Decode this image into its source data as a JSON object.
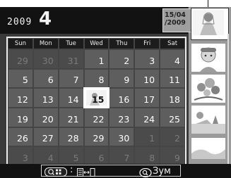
{
  "header": {
    "year": "2009",
    "month": "4"
  },
  "calendar": {
    "weekdays": [
      "Sun",
      "Mon",
      "Tue",
      "Wed",
      "Thu",
      "Fri",
      "Sat"
    ],
    "days": [
      {
        "d": "29",
        "cur": false
      },
      {
        "d": "30",
        "cur": false
      },
      {
        "d": "31",
        "cur": false
      },
      {
        "d": "1",
        "cur": true
      },
      {
        "d": "2",
        "cur": true
      },
      {
        "d": "3",
        "cur": true
      },
      {
        "d": "4",
        "cur": true
      },
      {
        "d": "5",
        "cur": true
      },
      {
        "d": "6",
        "cur": true
      },
      {
        "d": "7",
        "cur": true
      },
      {
        "d": "8",
        "cur": true
      },
      {
        "d": "9",
        "cur": true
      },
      {
        "d": "10",
        "cur": true
      },
      {
        "d": "11",
        "cur": true
      },
      {
        "d": "12",
        "cur": true
      },
      {
        "d": "13",
        "cur": true
      },
      {
        "d": "14",
        "cur": true
      },
      {
        "d": "15",
        "cur": true,
        "selected": true
      },
      {
        "d": "16",
        "cur": true
      },
      {
        "d": "17",
        "cur": true
      },
      {
        "d": "18",
        "cur": true
      },
      {
        "d": "19",
        "cur": true
      },
      {
        "d": "20",
        "cur": true
      },
      {
        "d": "21",
        "cur": true
      },
      {
        "d": "22",
        "cur": true
      },
      {
        "d": "23",
        "cur": true
      },
      {
        "d": "24",
        "cur": true
      },
      {
        "d": "25",
        "cur": true
      },
      {
        "d": "26",
        "cur": true
      },
      {
        "d": "27",
        "cur": true
      },
      {
        "d": "28",
        "cur": true
      },
      {
        "d": "29",
        "cur": true
      },
      {
        "d": "30",
        "cur": true
      },
      {
        "d": "1",
        "cur": false
      },
      {
        "d": "2",
        "cur": false
      },
      {
        "d": "3",
        "cur": false
      },
      {
        "d": "4",
        "cur": false
      },
      {
        "d": "5",
        "cur": false
      },
      {
        "d": "6",
        "cur": false
      },
      {
        "d": "7",
        "cur": false
      },
      {
        "d": "8",
        "cur": false
      },
      {
        "d": "9",
        "cur": false
      }
    ]
  },
  "thumbnails": {
    "selected_date_line1": "15/04",
    "selected_date_line2": "/2009",
    "items": [
      "wedding-photo-thumbnail",
      "child-photo-thumbnail",
      "flowers-photo-thumbnail",
      "beach-photo-thumbnail",
      "landscape-photo-thumbnail"
    ]
  },
  "footer": {
    "switch_separator": ":",
    "zoom_label": "Зум"
  },
  "colors": {
    "background": "#3a3a3a",
    "header": "#121212",
    "cell": "#5e5e5e",
    "cell_other": "#4b4b4b",
    "frame": "#ececec"
  }
}
